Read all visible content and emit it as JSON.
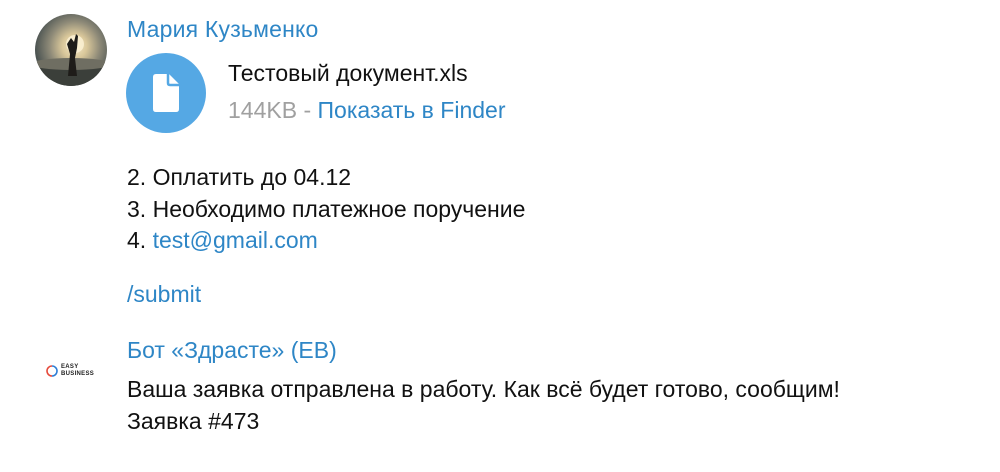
{
  "message_user": {
    "sender": "Мария Кузьменко",
    "avatar": "user-photo-avatar",
    "attachment": {
      "icon": "document-icon",
      "name": "Тестовый документ.xls",
      "size": "144KB",
      "separator": "-",
      "action": "Показать в Finder"
    },
    "lines": [
      {
        "prefix": "2. ",
        "text": "Оплатить до 04.12"
      },
      {
        "prefix": "3. ",
        "text": "Необходимо платежное поручение"
      },
      {
        "prefix": "4. ",
        "link": "test@gmail.com"
      }
    ],
    "command": "/submit"
  },
  "message_bot": {
    "sender": "Бот «Здрасте» (EB)",
    "avatar": "easy-business-logo",
    "logo_text_line1": "EASY",
    "logo_text_line2": "BUSINESS",
    "text_line1": "Ваша заявка отправлена в работу. Как всё будет готово, сообщим!",
    "text_line2": "Заявка #473"
  },
  "colors": {
    "link": "#2e86c6",
    "file_icon_bg": "#55a8e4",
    "meta_gray": "#a0a0a0",
    "text": "#111111",
    "logo_ring_a": "#e64b3c",
    "logo_ring_b": "#2f7fd6"
  }
}
